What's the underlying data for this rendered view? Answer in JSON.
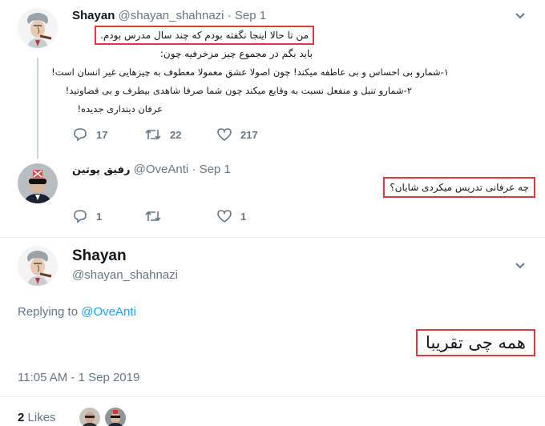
{
  "tweet1": {
    "name": "Shayan",
    "handle": "@shayan_shahnazi",
    "separator": "·",
    "date": "Sep 1",
    "line1": "من تا حالا اینجا نگفته بودم که چند سال مدرس  بودم.",
    "line2": "باید بگم در مجموع چیز مزخرفیه چون:",
    "line3": "۱-شمارو بی احساس و بی عاطفه میکند! چون اصولا عشق معمولا معطوف به چیزهایی غیر انسان است!",
    "line4": "۲-شمارو تنبل و منفعل نسبت به وقایع میکند چون شما صرفا شاهدی بیطرف و بی قضاوتید!",
    "line5": "عرفان دینداری جدیده!",
    "replies": "17",
    "retweets": "22",
    "likes": "217"
  },
  "tweet2": {
    "name": "رفیق پوتین",
    "handle": "@OveAnti",
    "separator": "·",
    "date": "Sep 1",
    "text": "چه عرفانی تدریس میکردی شایان؟",
    "replies": "1",
    "retweets": "",
    "likes": "1"
  },
  "main": {
    "name": "Shayan",
    "handle": "@shayan_shahnazi",
    "replying_prefix": "Replying to",
    "replying_to": "@OveAnti",
    "text": "همه چی تقریبا",
    "timestamp": "11:05 AM - 1 Sep 2019",
    "likes_count": "2",
    "likes_label": "Likes"
  },
  "colors": {
    "highlight_box": "#d93a3a",
    "link": "#1da1f2",
    "muted": "#657786",
    "thread_line": "#ccd6dd"
  },
  "icons": [
    "caret-down-icon",
    "reply-icon",
    "retweet-icon",
    "like-icon",
    "avatar-caricature",
    "avatar-sunglasses"
  ]
}
